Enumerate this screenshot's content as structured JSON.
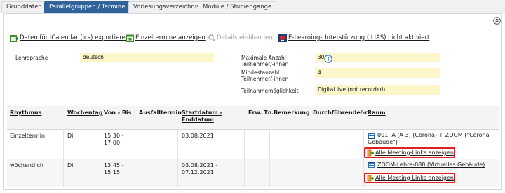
{
  "tabs": [
    {
      "label": "Grunddaten",
      "active": false
    },
    {
      "label": "Parallelgruppen / Termine",
      "active": true
    },
    {
      "label": "Vorlesungsverzeichnis",
      "active": false
    },
    {
      "label": "Module / Studiengänge",
      "active": false
    }
  ],
  "toolbar": {
    "ical_label": "Daten für iCalendar (ics) exportieren",
    "single_dates_label": "Einzeltermine anzeigen",
    "details_label": "Details einblenden",
    "elearning_label": "E-Learning-Unterstützung (ILIAS) nicht aktiviert"
  },
  "info": {
    "language_label": "Lehrsprache",
    "language_value": "deutsch",
    "max_label": "Maximale Anzahl Teilnehmer/-innen",
    "max_value": "30",
    "min_label": "Mindestanzahl Teilnehmer/-innen",
    "min_value": "4",
    "mode_label": "Teilnahmemöglichkeit",
    "mode_value": "Digital live (not recorded)"
  },
  "table": {
    "headers": {
      "rhythm": "Rhythmus",
      "weekday": "Wochentag",
      "time": "Von - Bis",
      "cancel": "Ausfalltermin",
      "date": "Startdatum - Enddatum",
      "exp": "Erw. Tn.",
      "note": "Bemerkung",
      "lecturer": "Durchführende/-r",
      "room": "Raum"
    },
    "rows": [
      {
        "rhythm": "Einzeltermin",
        "weekday": "Di",
        "time_start": "15:30 -",
        "time_end": "17:00",
        "date_start": "03.08.2021",
        "date_end": "",
        "room_line1": "001. A (A 3) (Corona) + ZOOM (\"Corona-",
        "room_line2": "Gebäude\")",
        "meeting_label": "Alle Meeting-Links anzeigen"
      },
      {
        "rhythm": "wöchentlich",
        "weekday": "Di",
        "time_start": "13:45 -",
        "time_end": "15:15",
        "date_start": "03.08.2021 -",
        "date_end": "07.12.2021",
        "room_line1": "ZOOM-Lehre-088 (Virtuelles Gebäude)",
        "room_line2": "",
        "meeting_label": "Alle Meeting-Links anzeigen"
      }
    ]
  },
  "colors": {
    "active_tab": "#30639a",
    "highlight_value_bg": "#fdf6c9",
    "meeting_box_border": "#e02020",
    "info_icon": "#2a6fd6"
  }
}
